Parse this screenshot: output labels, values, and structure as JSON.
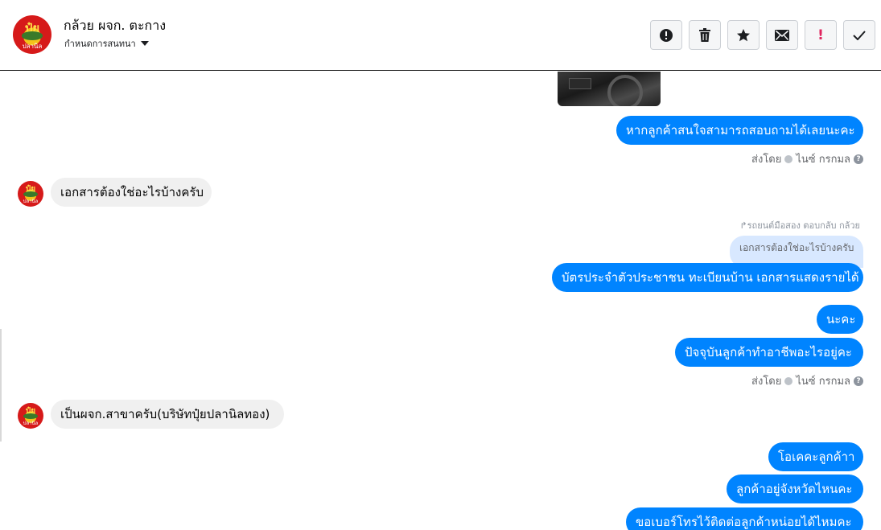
{
  "header": {
    "title": "กล้วย ผจก. ตะกาง",
    "subtitle": "กำหนดการสนทนา",
    "avatar_top": "ปุ๋ย",
    "avatar_bottom": "ปลานิล",
    "toolbar": [
      {
        "icon": "alert-circle-icon",
        "label": "Mark as spam"
      },
      {
        "icon": "trash-icon",
        "label": "Delete"
      },
      {
        "icon": "star-icon",
        "label": "Star"
      },
      {
        "icon": "envelope-icon",
        "label": "Mark as unread"
      },
      {
        "icon": "exclamation-icon",
        "label": "Follow up"
      },
      {
        "icon": "checkmark-icon",
        "label": "Done"
      }
    ]
  },
  "messages": {
    "m1": "หากลูกค้าสนใจสามารถสอบถามได้เลยนะคะ",
    "meta1_prefix": "ส่งโดย",
    "meta1_name": "ไนซ์ กรกมล",
    "m2": "เอกสารต้องใช่อะไรบ้างครับ",
    "reply_note": "รถยนต์มือสอง ตอบกลับ กล้วย",
    "reply_quote": "เอกสารต้องใช่อะไรบ้างครับ",
    "m3": "บัตรประจำตัวประชาชน ทะเบียนบ้าน เอกสารแสดงรายได้",
    "m4": "นะคะ",
    "m5": "ปัจจุบันลูกค้าทำอาชีพอะไรอยู่คะ",
    "meta2_prefix": "ส่งโดย",
    "meta2_name": "ไนซ์ กรกมล",
    "m6": "เป็นผจก.สาขาครับ(บริษัทปุ๋ยปลานิลทอง)",
    "m7": "โอเคคะลูกค้าา",
    "m8": "ลูกค้าอยู่จังหวัดไหนคะ",
    "m9": "ขอเบอร์โทรไว้ติดต่อลูกค้าหน่อยได้ไหมคะ"
  },
  "colors": {
    "outgoing_bubble": "#0084ff",
    "incoming_bubble": "#f0f0f0",
    "reply_quote": "#d8e8ff"
  }
}
